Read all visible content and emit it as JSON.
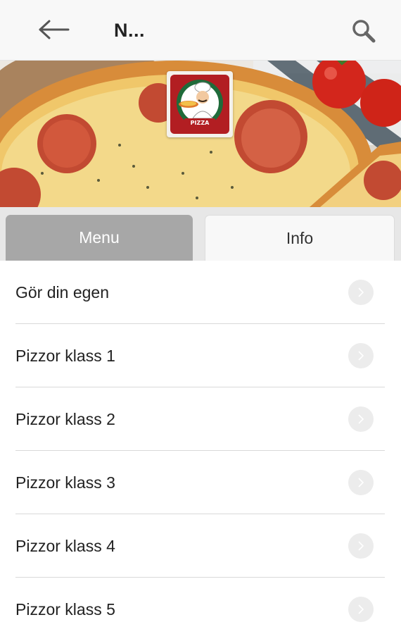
{
  "header": {
    "title": "N...",
    "back_icon": "arrow-left-icon",
    "search_icon": "search-icon"
  },
  "banner": {
    "logo_text": "PIZZA"
  },
  "tabs": [
    {
      "label": "Menu",
      "active": true
    },
    {
      "label": "Info",
      "active": false
    }
  ],
  "menu_items": [
    {
      "label": "Gör din egen"
    },
    {
      "label": "Pizzor klass 1"
    },
    {
      "label": "Pizzor klass 2"
    },
    {
      "label": "Pizzor klass 3"
    },
    {
      "label": "Pizzor klass 4"
    },
    {
      "label": "Pizzor klass 5"
    }
  ],
  "colors": {
    "active_tab": "#a7a7a7",
    "inactive_tab": "#f8f8f8",
    "logo_red": "#b21e22",
    "logo_green": "#1f6b3a"
  }
}
